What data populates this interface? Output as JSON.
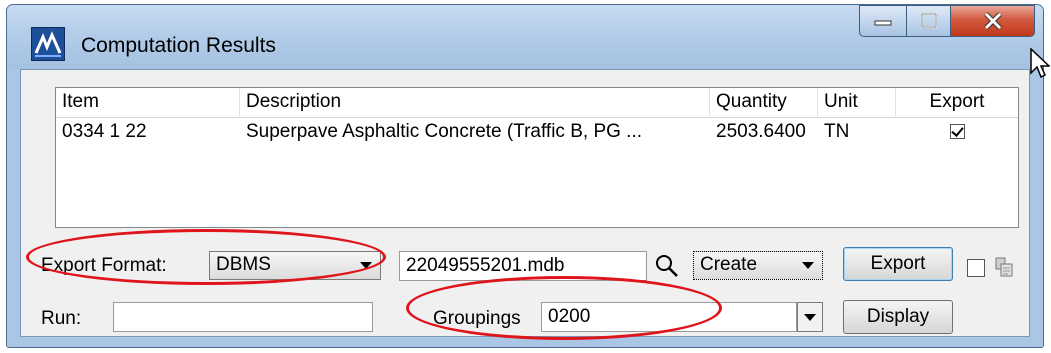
{
  "window": {
    "title": "Computation Results",
    "controls": {
      "minimize": "minimize",
      "maximize": "maximize",
      "close": "close"
    }
  },
  "table": {
    "columns": [
      "Item",
      "Description",
      "Quantity",
      "Unit",
      "Export"
    ],
    "rows": [
      {
        "item": "0334  1 22",
        "description": "Superpave Asphaltic Concrete (Traffic B, PG ...",
        "quantity": "2503.6400",
        "unit": "TN",
        "export_checked": true
      }
    ]
  },
  "export": {
    "format_label": "Export Format:",
    "format_value": "DBMS",
    "file_value": "22049555201.mdb",
    "mode_value": "Create",
    "export_button": "Export",
    "extra_checked": false
  },
  "run": {
    "label": "Run:",
    "value": ""
  },
  "groupings": {
    "label": "Groupings",
    "value": "0200"
  },
  "display_button": "Display",
  "colors": {
    "annotation": "#e0141b",
    "frame": "#a9c6e4",
    "close": "#c1381c"
  }
}
